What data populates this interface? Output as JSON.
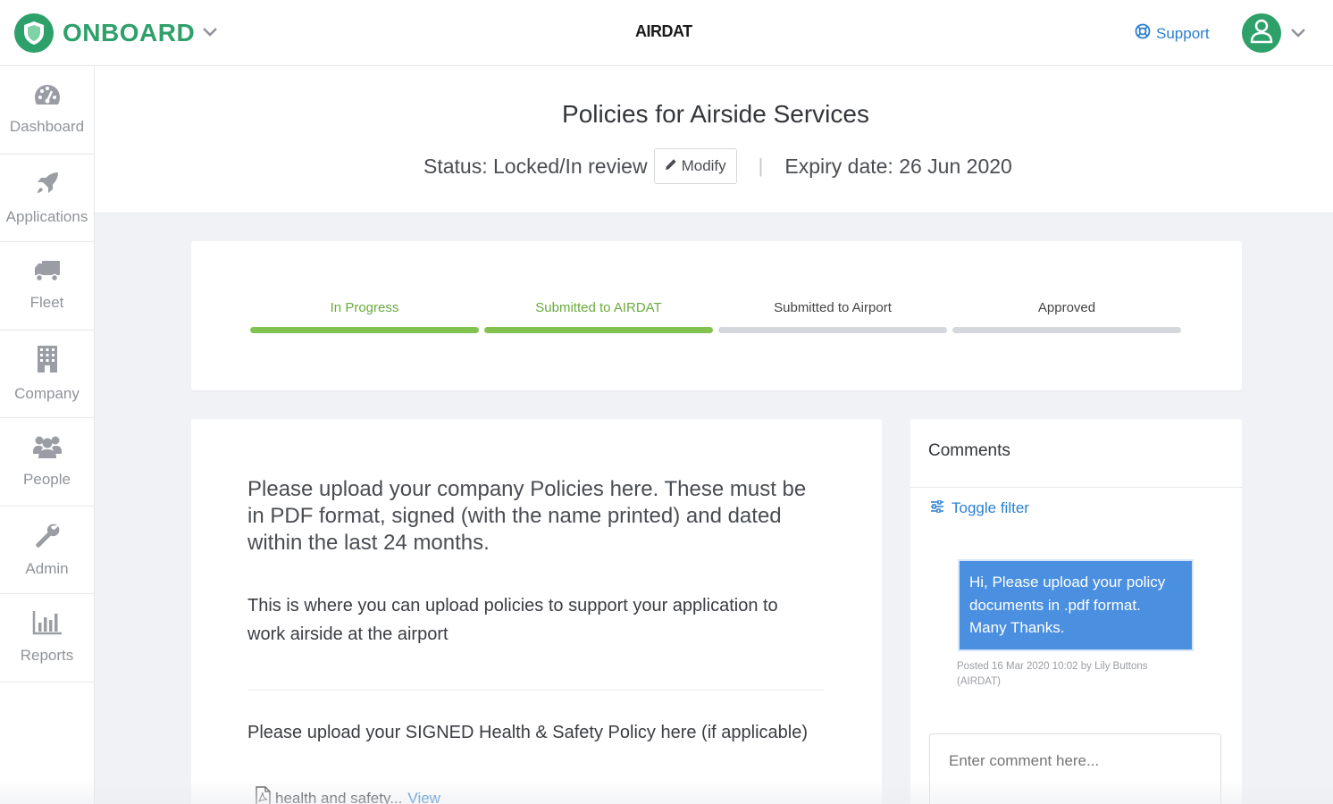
{
  "header": {
    "brand": "ONBOARD",
    "center_logo": "AIRDAT",
    "support_label": "Support",
    "icons": {
      "brand": "shield-icon",
      "support": "lifebuoy-icon",
      "avatar": "user-icon",
      "chevron": "chevron-down-icon"
    }
  },
  "sidebar": {
    "items": [
      {
        "label": "Dashboard",
        "icon": "dashboard-icon"
      },
      {
        "label": "Applications",
        "icon": "rocket-icon"
      },
      {
        "label": "Fleet",
        "icon": "truck-icon"
      },
      {
        "label": "Company",
        "icon": "building-icon"
      },
      {
        "label": "People",
        "icon": "people-icon"
      },
      {
        "label": "Admin",
        "icon": "wrench-icon"
      },
      {
        "label": "Reports",
        "icon": "bar-chart-icon"
      }
    ]
  },
  "page": {
    "title": "Policies for Airside Services",
    "status": "Status: Locked/In review",
    "modify_label": "Modify",
    "expiry": "Expiry date: 26 Jun 2020"
  },
  "progress": {
    "steps": [
      {
        "label": "In Progress",
        "complete": true
      },
      {
        "label": "Submitted to AIRDAT",
        "complete": true
      },
      {
        "label": "Submitted to Airport",
        "complete": false
      },
      {
        "label": "Approved",
        "complete": false
      }
    ],
    "colors": {
      "complete": "#82c250",
      "pending": "#d4d7dc"
    }
  },
  "main": {
    "intro": "Please upload your company Policies here. These must be in PDF format, signed (with the name printed) and dated within the last 24 months.",
    "description": "This is where you can upload policies to support your application to work airside at the airport",
    "upload_label": "Please upload your SIGNED Health & Safety Policy here (if applicable)",
    "file_name": "health and safety...",
    "file_link": "View"
  },
  "comments": {
    "title": "Comments",
    "toggle_filter": "Toggle filter",
    "message": "Hi, Please upload your policy documents in .pdf format. Many Thanks.",
    "meta": "Posted 16 Mar 2020 10:02 by Lily Buttons (AIRDAT)",
    "input_placeholder": "Enter comment here..."
  },
  "colors": {
    "brand_green": "#2ea06a",
    "link_blue": "#2a7fd0",
    "bubble_blue": "#4a8fe0"
  }
}
